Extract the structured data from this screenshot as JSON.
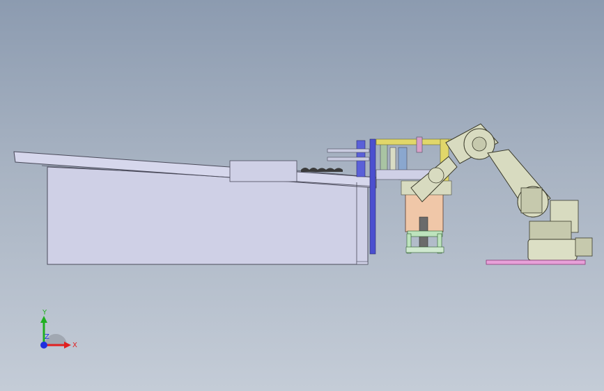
{
  "viewport": {
    "background_top": "#8c9bb0",
    "background_bottom": "#c4ccd7"
  },
  "model": {
    "components": [
      "conveyor-table",
      "pallet-frame",
      "gripper-station",
      "industrial-robot",
      "robot-base-plate"
    ],
    "colors": {
      "table_fill": "#cfd0e6",
      "robot_body": "#d8dbc0",
      "frame_yellow": "#e1d76a",
      "pedestal_orange": "#f0c7a8",
      "base_plate": "#e7a0d8",
      "rail_blue": "#4b4fcf"
    }
  },
  "triad": {
    "x_label": "X",
    "y_label": "Y",
    "z_label": "Z",
    "x_color": "#e02020",
    "y_color": "#20b020",
    "z_color": "#2030e0"
  }
}
